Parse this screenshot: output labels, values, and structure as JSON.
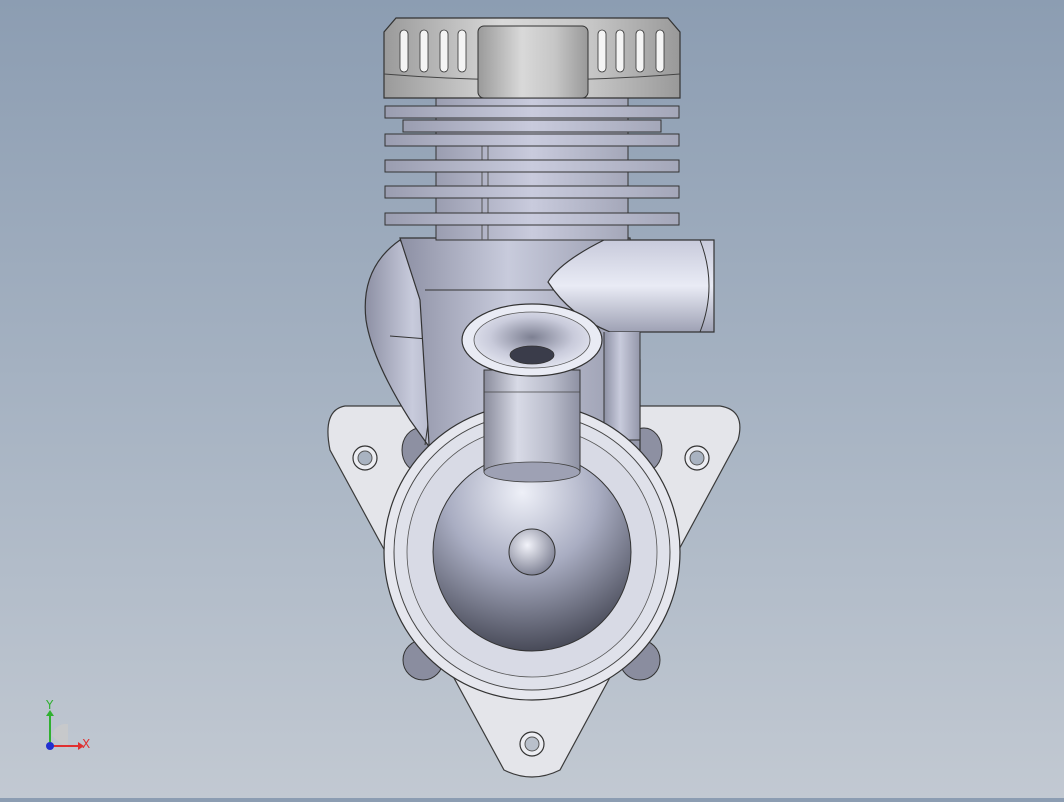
{
  "viewport": {
    "background_top": "#8c9db2",
    "background_bottom": "#c2c9d2",
    "model": "engine"
  },
  "triad": {
    "x_label": "X",
    "y_label": "Y",
    "x_color": "#e03030",
    "y_color": "#30b030",
    "z_color": "#2030d0"
  }
}
